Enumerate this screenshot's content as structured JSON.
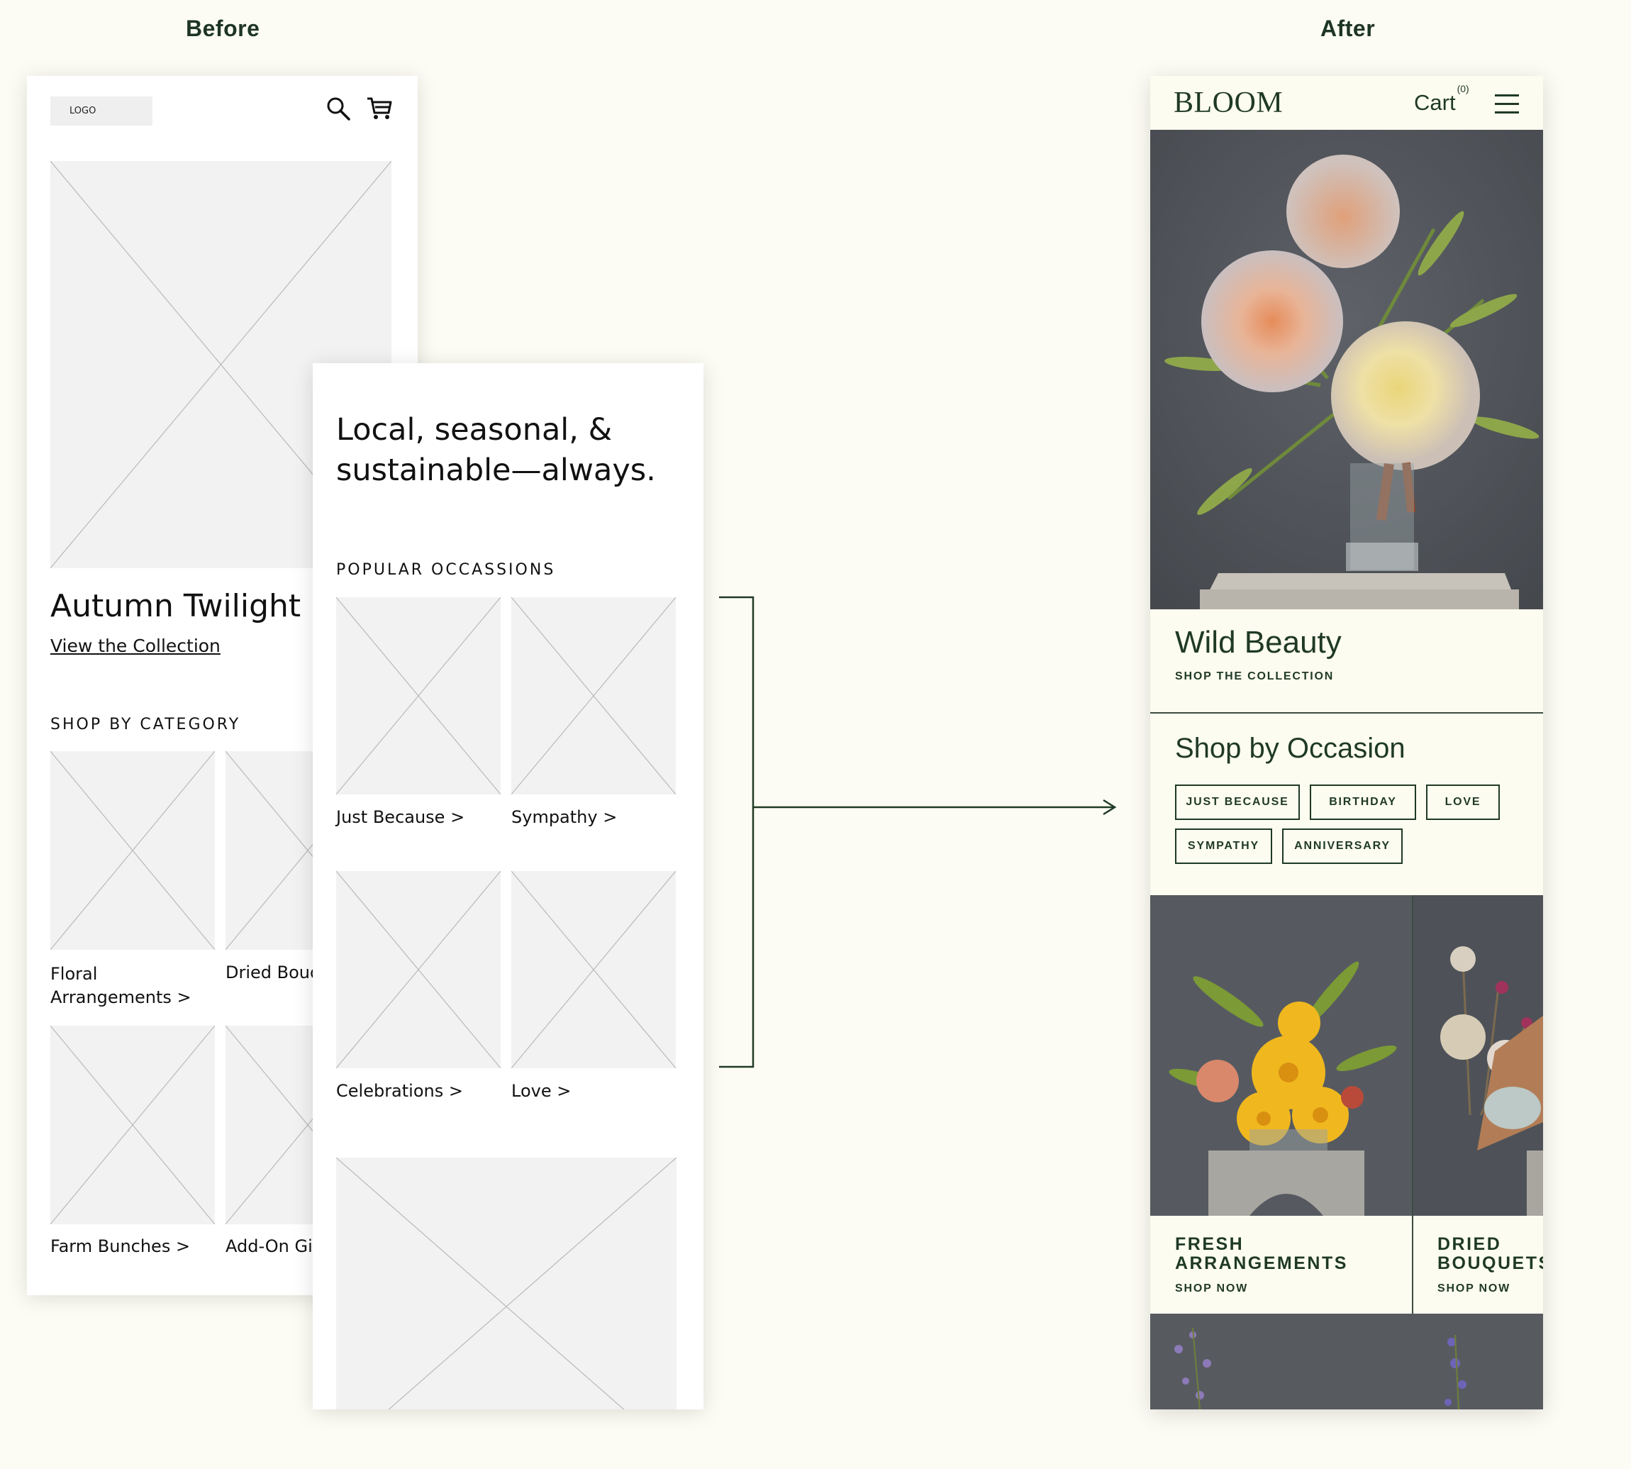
{
  "labels": {
    "before": "Before",
    "after": "After"
  },
  "before_home": {
    "logo": "LOGO",
    "hero_title": "Autumn Twilight",
    "hero_link": "View the Collection",
    "section_title": "SHOP BY CATEGORY",
    "categories": [
      "Floral",
      "Arrangements >",
      "Dried Bouq",
      "Farm Bunches >",
      "Add-On Gi"
    ]
  },
  "before_occasions": {
    "tagline_line1": "Local, seasonal, &",
    "tagline_line2": "sustainable—always.",
    "section_title": "POPULAR OCCASSIONS",
    "items": [
      "Just Because >",
      "Sympathy >",
      "Celebrations >",
      "Love >"
    ]
  },
  "after": {
    "brand": "BLOOM",
    "cart_label": "Cart",
    "cart_count": "(0)",
    "hero_title": "Wild Beauty",
    "hero_link": "SHOP THE COLLECTION",
    "occasion_title": "Shop by Occasion",
    "chips": [
      "JUST BECAUSE",
      "BIRTHDAY",
      "LOVE",
      "SYMPATHY",
      "ANNIVERSARY"
    ],
    "categories": [
      {
        "line1": "FRESH",
        "line2": "ARRANGEMENTS",
        "cta": "SHOP NOW"
      },
      {
        "line1": "DRIED",
        "line2": "BOUQUETS",
        "cta": "SHOP NOW"
      }
    ]
  },
  "colors": {
    "page_bg": "#fdfcf4",
    "brand_green": "#1f3a24",
    "wire_placeholder": "#f2f2f2",
    "photo_backdrop": "#55595e"
  }
}
